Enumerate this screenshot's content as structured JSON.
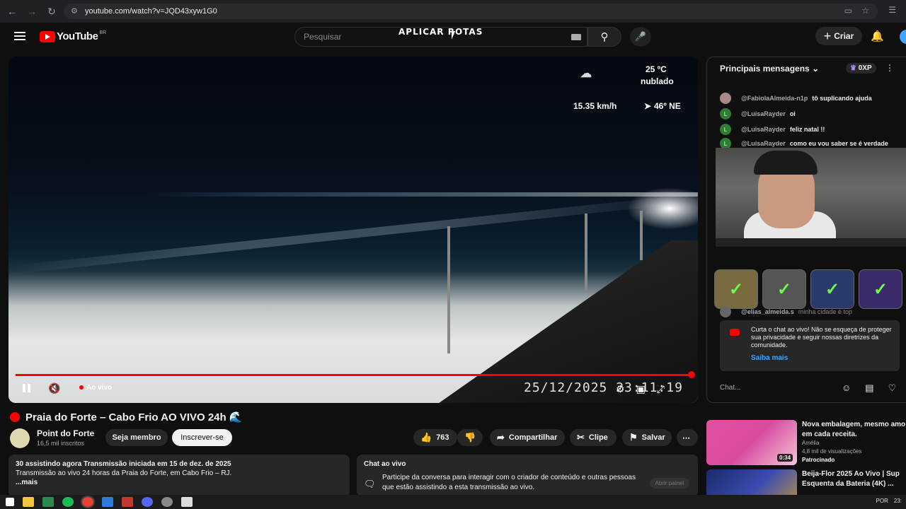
{
  "browser": {
    "url": "youtube.com/watch?v=JQD43xyw1G0"
  },
  "header": {
    "logo_text": "YouTube",
    "country_code": "BR",
    "search_placeholder": "Pesquisar",
    "overlay_text": "APLICAR ROTAS",
    "create_label": "Criar"
  },
  "player": {
    "temperature": "25 ºC",
    "condition": "nublado",
    "wind_speed": "15.35 km/h",
    "wind_dir": "46º NE",
    "live_label": "Ao vivo",
    "timestamp": "25/12/2025 23:11:19",
    "progress_fraction": 1.0
  },
  "video": {
    "title": "Praia do Forte – Cabo Frio AO VIVO 24h 🌊",
    "channel_name": "Point do Forte",
    "subscribers": "16,5 mil inscritos",
    "member_label": "Seja membro",
    "subscribe_label": "Inscrever-se",
    "likes": "763",
    "share_label": "Compartilhar",
    "clip_label": "Clipe",
    "save_label": "Salvar"
  },
  "description": {
    "line1": "30 assistindo agora  Transmissão iniciada em 15 de dez. de 2025",
    "line2": "Transmissão ao vivo 24 horas da Praia do Forte, em Cabo Frio – RJ.",
    "more": "...mais"
  },
  "chat_live_box": {
    "heading": "Chat ao vivo",
    "text": "Participe da conversa para interagir com o criador de conteúdo e outras pessoas que estão assistindo a esta transmissão ao vivo.",
    "open_label": "Abrir painel"
  },
  "chat": {
    "header": "Principais mensagens",
    "xp": "0XP",
    "messages": [
      {
        "user": "@FabiolaAlmeida-n1p",
        "text": "tô suplicando ajuda",
        "initial": ""
      },
      {
        "user": "@LuisaRayder",
        "text": "oi",
        "initial": "L"
      },
      {
        "user": "@LuisaRayder",
        "text": "feliz natal !!",
        "initial": "L"
      },
      {
        "user": "@LuisaRayder",
        "text": "como eu vou saber se é verdade",
        "initial": "L"
      }
    ],
    "partial_message": {
      "user": "@elias_almeida.s",
      "text": "minha cidade é top"
    },
    "notice_text": "Curta o chat ao vivo! Não se esqueça de proteger sua privacidade e seguir nossas diretrizes da comunidade.",
    "notice_link": "Saiba mais",
    "input_placeholder": "Chat..."
  },
  "recommendations": [
    {
      "title": "Nova embalagem, mesmo amo em cada receita.",
      "channel": "Amélia",
      "views": "4,8 mil de visualizações",
      "badge": "Patrocinado",
      "duration": "0:34"
    },
    {
      "title": "Beija-Flor 2025 Ao Vivo | Sup Esquenta da Bateria (4K) ...",
      "channel": "",
      "views": "",
      "badge": "",
      "duration": ""
    }
  ],
  "taskbar": {
    "lang": "POR",
    "time": "23:"
  }
}
